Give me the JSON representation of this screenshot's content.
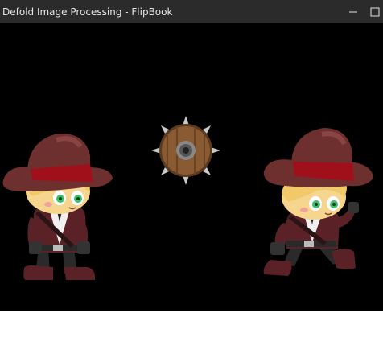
{
  "window": {
    "title": "Defold Image Processing - FlipBook",
    "controls": {
      "minimize_icon": "minimize-icon",
      "maximize_icon": "maximize-icon"
    }
  },
  "scene": {
    "background_color": "#000000",
    "sprites": [
      {
        "name": "adventurer-idle",
        "pose": "idle"
      },
      {
        "name": "spiked-shield",
        "pose": "static"
      },
      {
        "name": "adventurer-running",
        "pose": "run"
      }
    ]
  },
  "colors": {
    "titlebar": "#2b2b2b",
    "hat": "#6e2f2f",
    "hat_band": "#a0101a",
    "coat": "#5a2226",
    "skin": "#f6d58f",
    "hair": "#f2c96a",
    "eyes": "#3bbf6a",
    "shield_wood": "#8a5a32",
    "spikes": "#c9c9c9"
  }
}
